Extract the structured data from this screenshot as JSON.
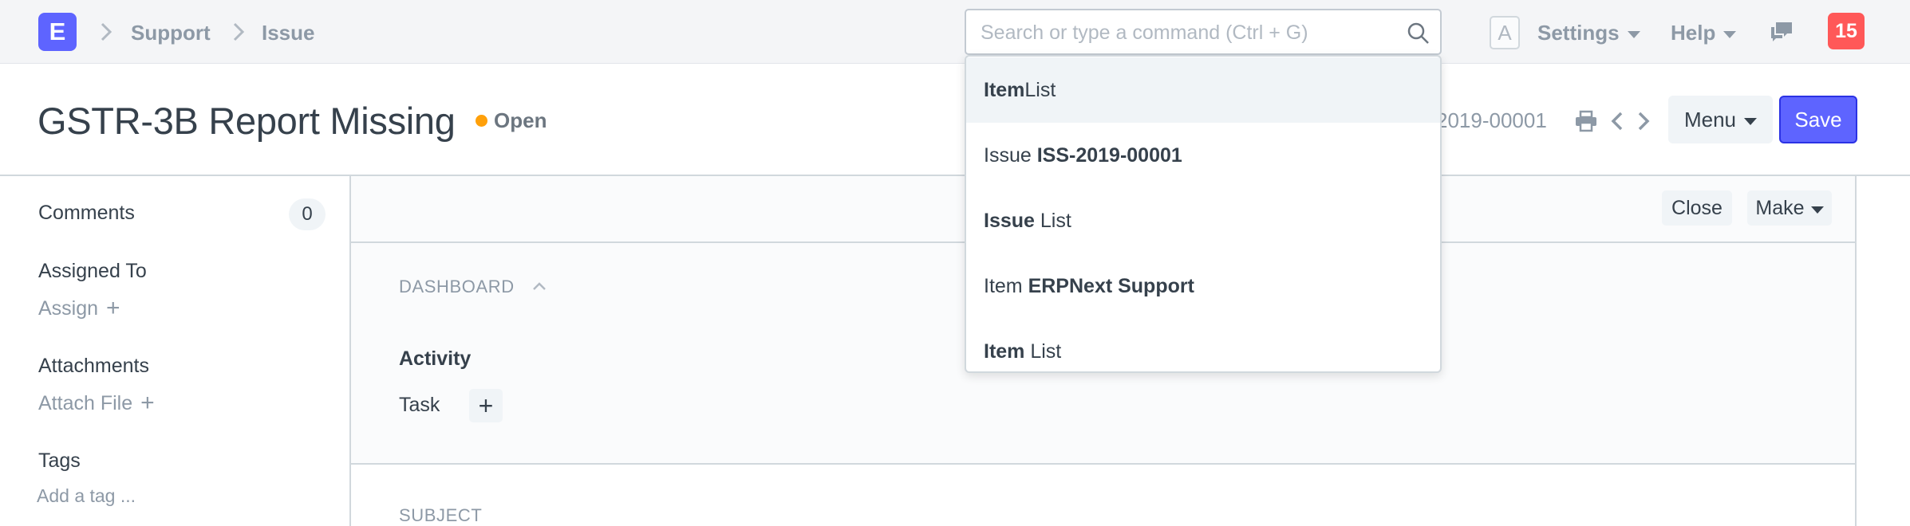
{
  "navbar": {
    "logo_letter": "E",
    "breadcrumbs": [
      "Support",
      "Issue"
    ],
    "search": {
      "placeholder": "Search or type a command (Ctrl + G)",
      "value": ""
    },
    "avatar_letter": "A",
    "settings_label": "Settings",
    "help_label": "Help",
    "notification_count": "15"
  },
  "page": {
    "title": "GSTR-3B Report Missing",
    "status": "Open",
    "status_color": "#ffa00a",
    "doc_name_visible": "2019-00001",
    "menu_label": "Menu",
    "save_label": "Save"
  },
  "sidebar": {
    "comments_label": "Comments",
    "comments_count": "0",
    "assigned_to_label": "Assigned To",
    "assign_link": "Assign",
    "attachments_label": "Attachments",
    "attach_link": "Attach File",
    "tags_label": "Tags",
    "add_tag_link": "Add a tag ..."
  },
  "form": {
    "close_label": "Close",
    "make_label": "Make",
    "dashboard_label": "DASHBOARD",
    "activity_label": "Activity",
    "task_label": "Task",
    "task_add": "+",
    "subject_label": "SUBJECT"
  },
  "search_results": [
    {
      "bold": "Item",
      "rest": " List",
      "bold_first": true,
      "active": true
    },
    {
      "prefix": "Issue ",
      "bold": "ISS-2019-00001",
      "bold_first": false,
      "active": false
    },
    {
      "bold": "Issue",
      "rest": " List",
      "bold_first": true,
      "active": false
    },
    {
      "prefix": "Item ",
      "bold": "ERPNext Support",
      "bold_first": false,
      "active": false
    },
    {
      "bold": "Item",
      "rest": " List",
      "bold_first": true,
      "active": false
    }
  ],
  "colors": {
    "primary": "#5e64ff",
    "notification": "#ff5858"
  }
}
